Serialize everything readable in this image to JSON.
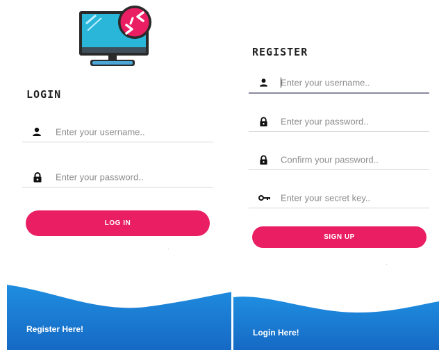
{
  "login": {
    "heading": "LOGIN",
    "username_placeholder": "Enter your username..",
    "password_placeholder": "Enter your password..",
    "login_button": "LOG IN",
    "register_link": "Register Here!"
  },
  "register": {
    "heading": "REGISTER",
    "username_placeholder": "Enter your username..",
    "password_placeholder": "Enter your password..",
    "confirm_placeholder": "Confirm your password..",
    "secret_placeholder": "Enter your secret key..",
    "signup_button": "SIGN UP",
    "login_link": "Login Here!"
  },
  "icons": {
    "logo": "monitor-remote-icon",
    "user": "person-icon",
    "lock": "lock-icon",
    "key": "key-icon"
  },
  "colors": {
    "accent": "#e91e63",
    "wave_blue": "#1976d2",
    "monitor_screen": "#29b6d8",
    "text_dark": "#222222",
    "placeholder": "#8c8c8c"
  }
}
